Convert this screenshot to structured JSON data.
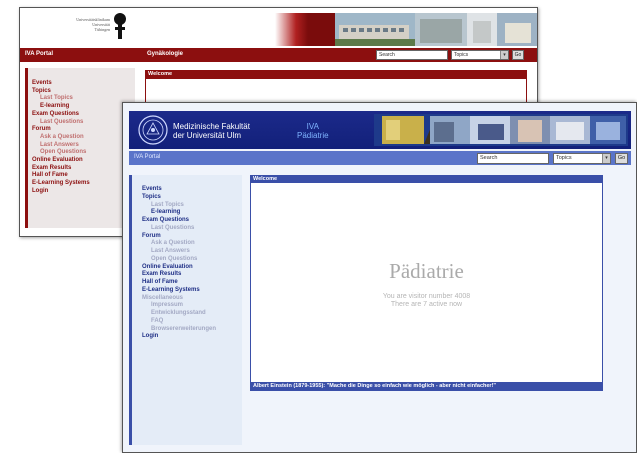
{
  "back_window": {
    "logo_lines": [
      "Universitätsklinikum",
      "Universität",
      "Tübingen"
    ],
    "nav": {
      "portal": "IVA Portal",
      "department": "Gynäkologie"
    },
    "search": {
      "value": "Search",
      "topics": "Topics",
      "go": "Go"
    },
    "menu": [
      {
        "label": "Events",
        "level": 0
      },
      {
        "label": "Topics",
        "level": 0
      },
      {
        "label": "Last Topics",
        "level": 1
      },
      {
        "label": "E-learning",
        "level": 1,
        "dark": true
      },
      {
        "label": "Exam Questions",
        "level": 0
      },
      {
        "label": "Last Questions",
        "level": 1
      },
      {
        "label": "Forum",
        "level": 0
      },
      {
        "label": "Ask a Question",
        "level": 1
      },
      {
        "label": "Last Answers",
        "level": 1
      },
      {
        "label": "Open Questions",
        "level": 1
      },
      {
        "label": "Online Evaluation",
        "level": 0
      },
      {
        "label": "Exam Results",
        "level": 0
      },
      {
        "label": "Hall of Fame",
        "level": 0
      },
      {
        "label": "E-Learning Systems",
        "level": 0
      },
      {
        "label": "Login",
        "level": 0
      }
    ],
    "welcome": "Welcome",
    "theme_color": "#8c0f0f"
  },
  "front_window": {
    "faculty_lines": [
      "Medizinische Fakultät",
      "der Universität Ulm"
    ],
    "iva_lines": [
      "IVA",
      "Pädiatrie"
    ],
    "nav": {
      "portal": "IVA Portal"
    },
    "search": {
      "value": "Search",
      "topics": "Topics",
      "go": "Go"
    },
    "menu": [
      {
        "label": "Events",
        "level": 0
      },
      {
        "label": "Topics",
        "level": 0
      },
      {
        "label": "Last Topics",
        "level": 1
      },
      {
        "label": "E-learning",
        "level": 1,
        "dark": true
      },
      {
        "label": "Exam Questions",
        "level": 0
      },
      {
        "label": "Last Questions",
        "level": 1
      },
      {
        "label": "Forum",
        "level": 0
      },
      {
        "label": "Ask a Question",
        "level": 1
      },
      {
        "label": "Last Answers",
        "level": 1
      },
      {
        "label": "Open Questions",
        "level": 1
      },
      {
        "label": "Online Evaluation",
        "level": 0
      },
      {
        "label": "Exam Results",
        "level": 0
      },
      {
        "label": "Hall of Fame",
        "level": 0
      },
      {
        "label": "E-Learning Systems",
        "level": 0
      },
      {
        "label": "Miscellaneous",
        "level": 0,
        "muted": true
      },
      {
        "label": "Impressum",
        "level": 1
      },
      {
        "label": "Entwicklungsstand",
        "level": 1
      },
      {
        "label": "FAQ",
        "level": 1
      },
      {
        "label": "Browsererweiterungen",
        "level": 1
      },
      {
        "label": "Login",
        "level": 0
      }
    ],
    "welcome": "Welcome",
    "content_title": "Pädiatrie",
    "visitor_line1": "You are visitor number 4008",
    "visitor_line2": "There are 7 active now",
    "quote": "Albert Einstein (1879-1955): \"Mache die Dinge so einfach wie möglich - aber nicht einfacher!\"",
    "theme_color": "#3a4fa8"
  }
}
